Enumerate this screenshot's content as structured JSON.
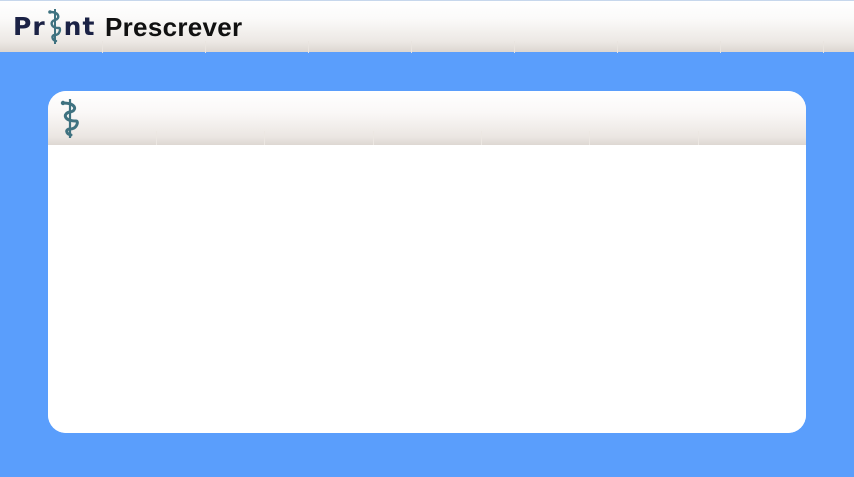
{
  "header": {
    "logo_left": "Pr",
    "logo_right": "nt",
    "logo_icon": "caduceus-icon",
    "title": "Prescrever"
  },
  "panel": {
    "icon": "caduceus-icon"
  },
  "colors": {
    "background": "#5a9efc",
    "logo_text": "#1b2245",
    "caduceus": "#3f7280"
  }
}
